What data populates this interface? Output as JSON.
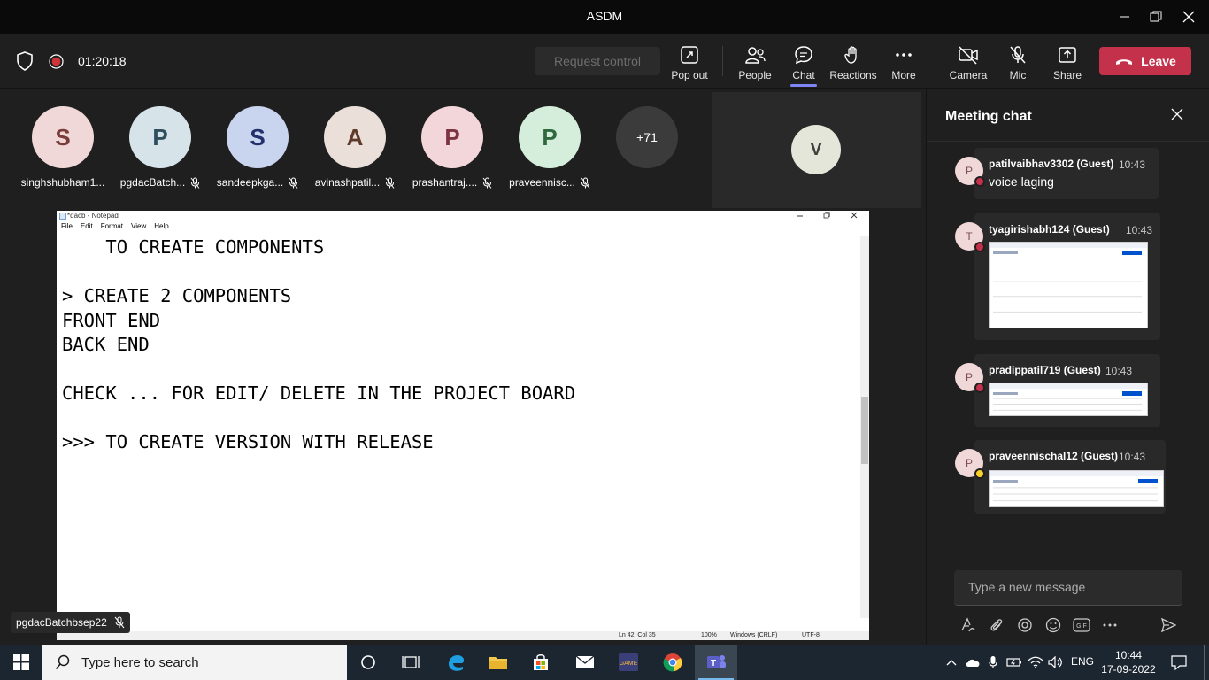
{
  "window": {
    "title": "ASDM"
  },
  "toolbar": {
    "timer": "01:20:18",
    "request_control": "Request control",
    "pop_out": "Pop out",
    "people": "People",
    "chat": "Chat",
    "reactions": "Reactions",
    "more": "More",
    "camera": "Camera",
    "mic": "Mic",
    "share": "Share",
    "leave": "Leave"
  },
  "participants": [
    {
      "initial": "S",
      "name": "singhshubham1...",
      "bg": "#f1d8d8",
      "fg": "#7a3b3b",
      "muted": false
    },
    {
      "initial": "P",
      "name": "pgdacBatch...",
      "bg": "#d6e4ea",
      "fg": "#2f4f5f",
      "muted": true
    },
    {
      "initial": "S",
      "name": "sandeepkga...",
      "bg": "#c9d4ee",
      "fg": "#23306b",
      "muted": true
    },
    {
      "initial": "A",
      "name": "avinashpatil...",
      "bg": "#eadfd9",
      "fg": "#5e3a2a",
      "muted": true
    },
    {
      "initial": "P",
      "name": "prashantraj....",
      "bg": "#f3d6da",
      "fg": "#7b3440",
      "muted": true
    },
    {
      "initial": "P",
      "name": "praveennisc...",
      "bg": "#d4eedb",
      "fg": "#2f6a3f",
      "muted": true
    }
  ],
  "more_participants": "+71",
  "spotlight": {
    "initial": "V"
  },
  "notepad": {
    "title": "*dacb - Notepad",
    "menu": [
      "File",
      "Edit",
      "Format",
      "View",
      "Help"
    ],
    "lines": [
      "    TO CREATE COMPONENTS",
      "",
      "> CREATE 2 COMPONENTS",
      "FRONT END",
      "BACK END",
      "",
      "CHECK ... FOR EDIT/ DELETE IN THE PROJECT BOARD",
      "",
      ">>> TO CREATE VERSION WITH RELEASE"
    ],
    "status": {
      "position": "Ln 42, Col 35",
      "zoom": "100%",
      "line_ending": "Windows (CRLF)",
      "encoding": "UTF-8"
    }
  },
  "presenter": "pgdacBatchbsep22",
  "chat": {
    "title": "Meeting chat",
    "messages": [
      {
        "initial": "P",
        "sender": "patilvaibhav3302 (Guest)",
        "time": "10:43",
        "text": "voice laging",
        "status_color": "#c4314b"
      },
      {
        "initial": "T",
        "sender": "tyagirishabh124 (Guest)",
        "time": "10:43",
        "text": "",
        "status_color": "#c4314b"
      },
      {
        "initial": "P",
        "sender": "pradippatil719 (Guest)",
        "time": "10:43",
        "text": "",
        "status_color": "#c4314b"
      },
      {
        "initial": "P",
        "sender": "praveennischal12 (Guest)",
        "time": "10:43",
        "text": "",
        "status_color": "#f8d22a"
      }
    ],
    "compose_placeholder": "Type a new message"
  },
  "taskbar": {
    "search_placeholder": "Type here to search",
    "language": "ENG",
    "time": "10:44",
    "date": "17-09-2022"
  }
}
